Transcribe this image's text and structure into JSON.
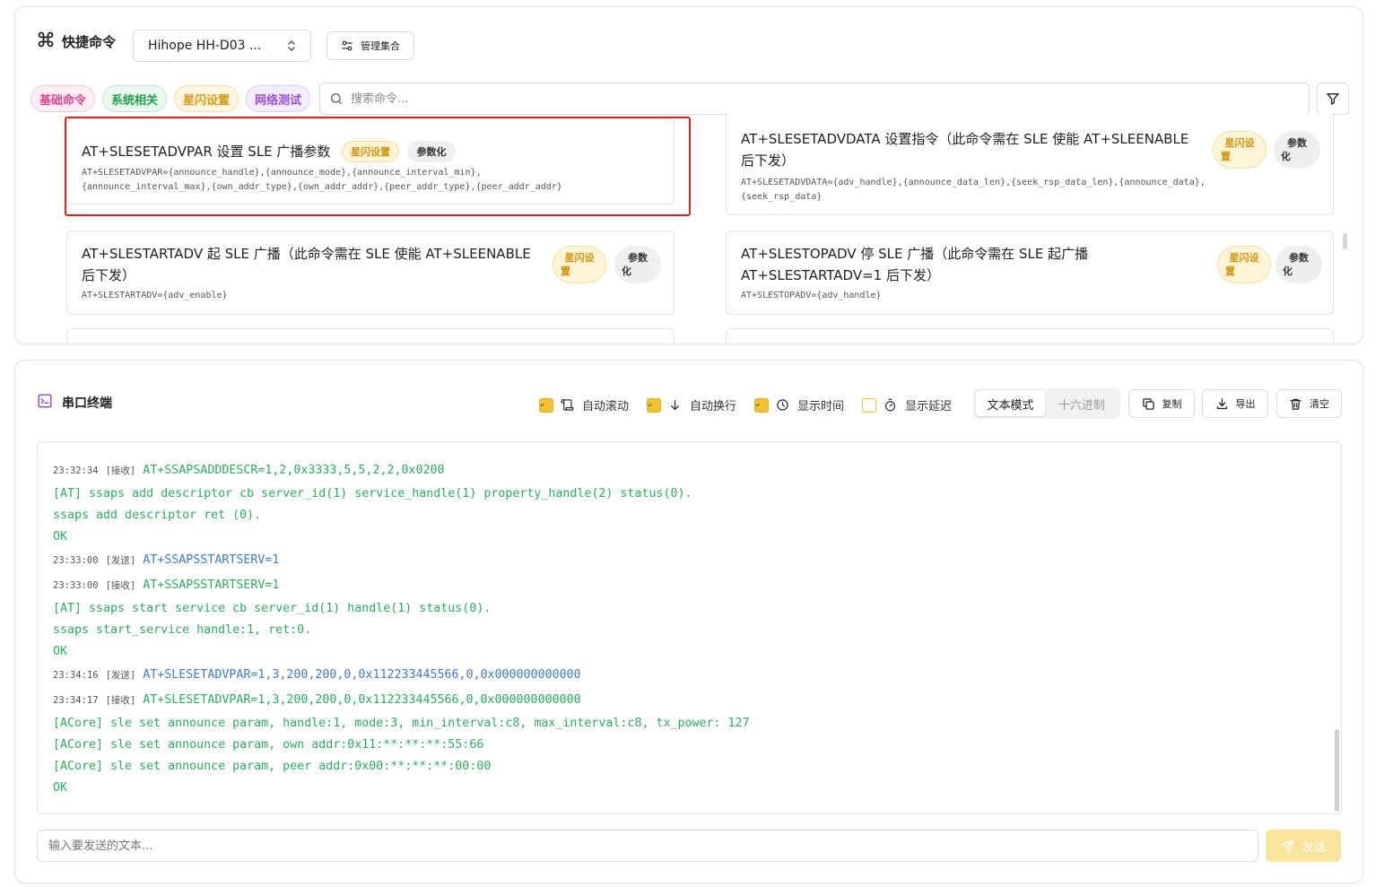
{
  "quick": {
    "title": "快捷命令",
    "device": "Hihope HH-D03 ...",
    "manage_label": "管理集合",
    "tags": [
      "基础命令",
      "系统相关",
      "星闪设置",
      "网络测试"
    ],
    "search_placeholder": "搜索命令...",
    "cards": [
      {
        "title": "AT+SLESETADVPAR 设置 SLE 广播参数",
        "syntax_line1": "AT+SLESETADVPAR={announce_handle},{announce_mode},{announce_interval_min},",
        "syntax_line2": "{announce_interval_max},{own_addr_type},{own_addr_addr},{peer_addr_type},{peer_addr_addr}",
        "tag": "星闪设置",
        "param": "参数化"
      },
      {
        "title_line1": "AT+SLESETADVDATA 设置指令（此命令需在 SLE 使能 AT+SLEENABLE",
        "title_line2": "后下发）",
        "syntax_line1": "AT+SLESETADVDATA={adv_handle},{announce_data_len},{seek_rsp_data_len},{announce_data},",
        "syntax_line2": "{seek_rsp_data}",
        "tag_line1": "星闪设",
        "tag_line2": "置",
        "param_line1": "参数",
        "param_line2": "化"
      },
      {
        "title_line1": "AT+SLESTARTADV 起 SLE 广播（此命令需在 SLE 使能 AT+SLEENABLE",
        "title_line2": "后下发）",
        "syntax_line1": "AT+SLESTARTADV={adv_enable}",
        "tag_line1": "星闪设",
        "tag_line2": "置",
        "param_line1": "参数",
        "param_line2": "化"
      },
      {
        "title_line1": "AT+SLESTOPADV 停 SLE 广播（此命令需在 SLE 起广播",
        "title_line2": "AT+SLESTARTADV=1 后下发）",
        "syntax_line1": "AT+SLESTOPADV={adv_handle}",
        "tag_line1": "星闪设",
        "tag_line2": "置",
        "param_line1": "参数",
        "param_line2": "化"
      }
    ]
  },
  "terminal": {
    "title": "串口终端",
    "options": {
      "auto_scroll": "自动滚动",
      "auto_wrap": "自动换行",
      "show_time": "显示时间",
      "show_delay": "显示延迟"
    },
    "mode_text": "文本模式",
    "mode_hex": "十六进制",
    "copy_label": "复制",
    "export_label": "导出",
    "clear_label": "清空",
    "send_placeholder": "输入要发送的文本...",
    "send_label": "发送",
    "logs": [
      {
        "ts": "23:32:34",
        "dir": "[接收]",
        "text": "AT+SSAPSADDDESCR=1,2,0x3333,5,5,2,2,0x0200",
        "color": "green"
      },
      {
        "text": "[AT] ssaps add descriptor cb server_id(1) service_handle(1) property_handle(2) status(0).",
        "color": "green"
      },
      {
        "text": "ssaps add descriptor ret (0).",
        "color": "green"
      },
      {
        "text": "OK",
        "color": "green"
      },
      {
        "ts": "23:33:00",
        "dir": "[发送]",
        "text": "AT+SSAPSSTARTSERV=1",
        "color": "blue"
      },
      {
        "ts": "23:33:00",
        "dir": "[接收]",
        "text": "AT+SSAPSSTARTSERV=1",
        "color": "green"
      },
      {
        "text": "[AT] ssaps start service cb server_id(1) handle(1) status(0).",
        "color": "green"
      },
      {
        "text": "ssaps start_service handle:1, ret:0.",
        "color": "green"
      },
      {
        "text": "OK",
        "color": "green"
      },
      {
        "ts": "23:34:16",
        "dir": "[发送]",
        "text": "AT+SLESETADVPAR=1,3,200,200,0,0x112233445566,0,0x000000000000",
        "color": "blue"
      },
      {
        "ts": "23:34:17",
        "dir": "[接收]",
        "text": "AT+SLESETADVPAR=1,3,200,200,0,0x112233445566,0,0x000000000000",
        "color": "green"
      },
      {
        "text": "[ACore] sle set announce param, handle:1, mode:3, min_interval:c8, max_interval:c8, tx_power: 127",
        "color": "green"
      },
      {
        "text": "[ACore] sle set announce param, own addr:0x11:**:**:**:55:66",
        "color": "green"
      },
      {
        "text": "[ACore] sle set announce param, peer addr:0x00:**:**:**:00:00",
        "color": "green"
      },
      {
        "text": "OK",
        "color": "green"
      }
    ]
  },
  "colors": {
    "accent": "#f2c12e",
    "highlight_border": "#e0211c",
    "log_green": "#27ae60",
    "log_blue": "#3a7bd5"
  }
}
